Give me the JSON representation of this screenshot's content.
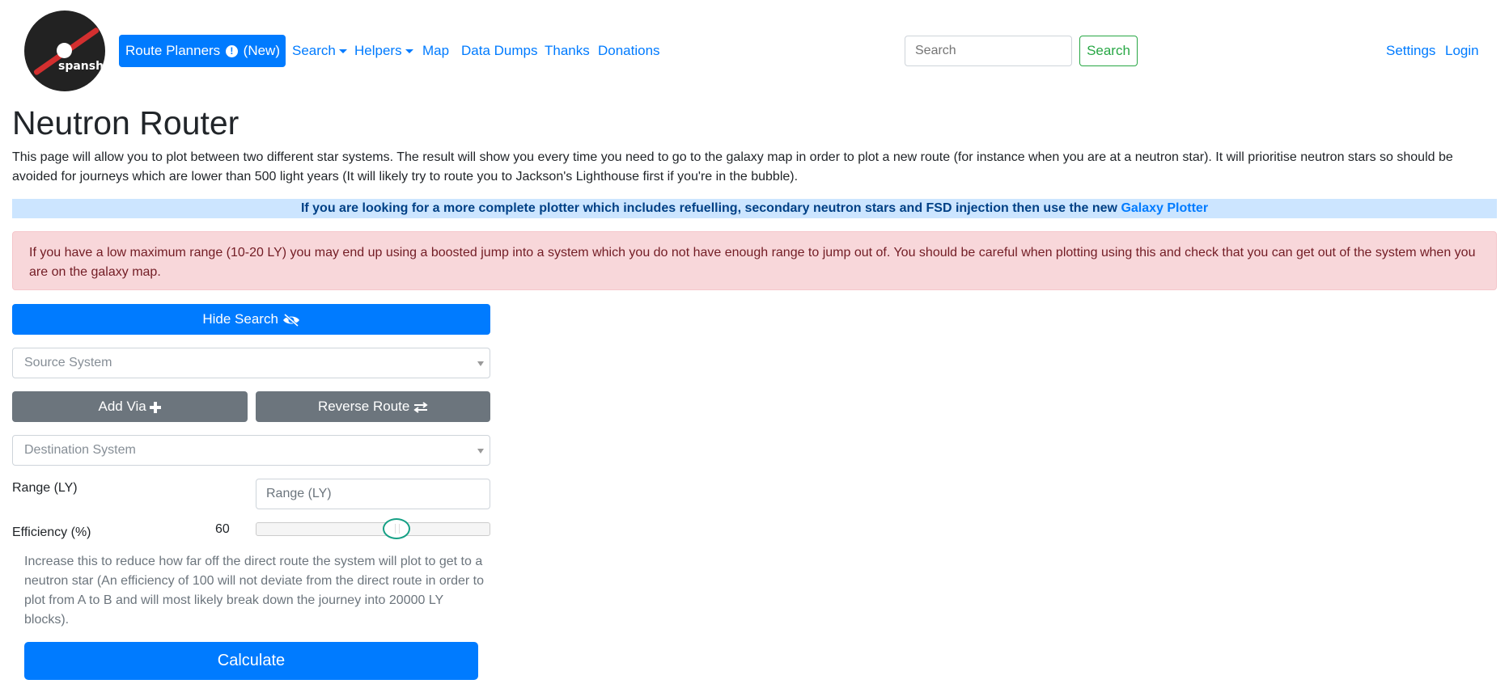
{
  "nav": {
    "logo_text": "spansh",
    "route_planners": "Route Planners",
    "route_planners_new": "(New)",
    "search": "Search",
    "helpers": "Helpers",
    "map": "Map",
    "data_dumps": "Data Dumps",
    "thanks": "Thanks",
    "donations": "Donations",
    "search_placeholder": "Search",
    "search_button": "Search",
    "settings": "Settings",
    "login": "Login"
  },
  "page": {
    "title": "Neutron Router",
    "intro": "This page will allow you to plot between two different star systems. The result will show you every time you need to go to the galaxy map in order to plot a new route (for instance when you are at a neutron star). It will prioritise neutron stars so should be avoided for journeys which are lower than 500 light years (It will likely try to route you to Jackson's Lighthouse first if you're in the bubble).",
    "promo_text": "If you are looking for a more complete plotter which includes refuelling, secondary neutron stars and FSD injection then use the new ",
    "promo_link": "Galaxy Plotter",
    "alert": "If you have a low maximum range (10-20 LY) you may end up using a boosted jump into a system which you do not have enough range to jump out of. You should be careful when plotting using this and check that you can get out of the system when you are on the galaxy map."
  },
  "form": {
    "hide_search": "Hide Search",
    "source_placeholder": "Source System",
    "add_via": "Add Via",
    "reverse_route": "Reverse Route",
    "destination_placeholder": "Destination System",
    "range_label": "Range (LY)",
    "range_placeholder": "Range (LY)",
    "efficiency_label": "Efficiency (%)",
    "efficiency_value": "60",
    "efficiency_min": 0,
    "efficiency_max": 100,
    "efficiency_help": "Increase this to reduce how far off the direct route the system will plot to get to a neutron star (An efficiency of 100 will not deviate from the direct route in order to plot from A to B and will most likely break down the journey into 20000 LY blocks).",
    "calculate": "Calculate"
  },
  "colors": {
    "primary": "#007bff",
    "secondary": "#6c757d",
    "success": "#28a745",
    "info_bg": "#cce5ff",
    "danger_bg": "#f8d7da",
    "slider_handle": "#16a085"
  }
}
